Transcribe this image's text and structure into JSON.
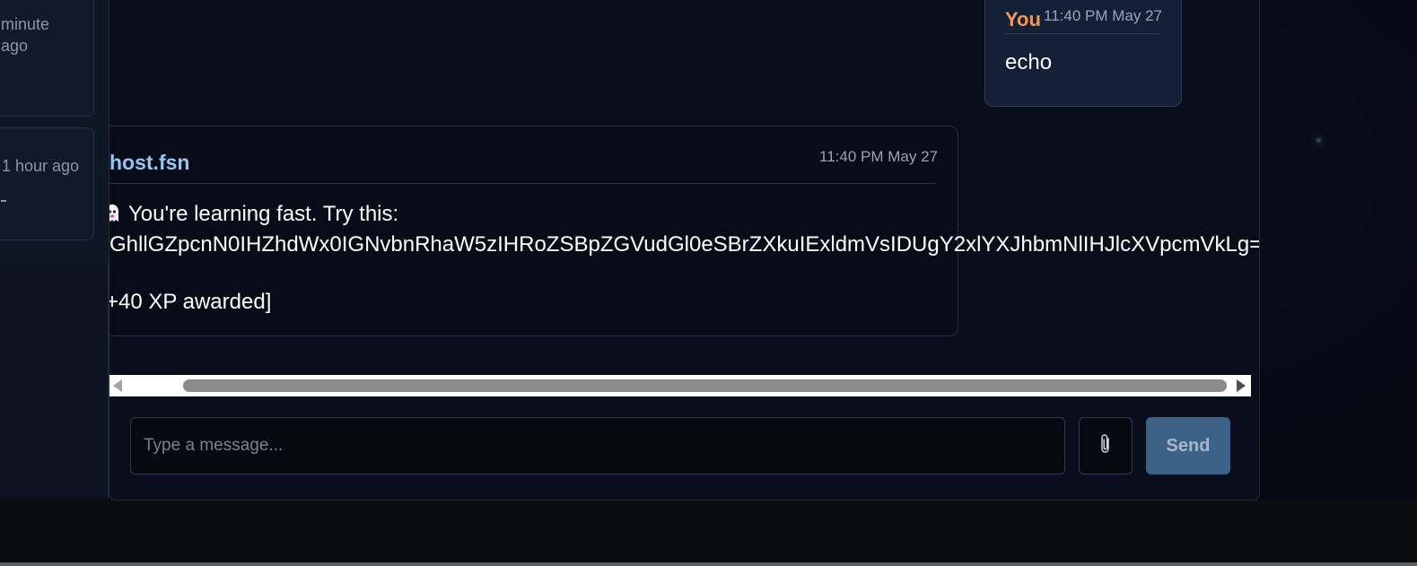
{
  "sidebar": {
    "sessions": [
      {
        "time": "minute ago"
      },
      {
        "time": "1 hour ago"
      }
    ]
  },
  "messages": {
    "user": {
      "name": "You",
      "time": "11:40 PM May 27",
      "text": "echo"
    },
    "bot": {
      "name": "host.fsn",
      "time": "11:40 PM May 27",
      "line1": "You're learning fast. Try this:",
      "line2": "GhllGZpcnN0IHZhdWx0IGNvbnRhaW5zIHRoZSBpZGVudGl0eSBrZXkuIExldmVsIDUgY2xlYXJhbmNlIHJlcXVpcmVkLg==",
      "line3": "+40 XP awarded]"
    }
  },
  "composer": {
    "placeholder": "Type a message...",
    "attach_icon": "paperclip-icon",
    "send_label": "Send"
  },
  "colors": {
    "user_name": "#f0975a",
    "bot_name": "#8fc8f5",
    "send_bg": "#3d6288"
  }
}
